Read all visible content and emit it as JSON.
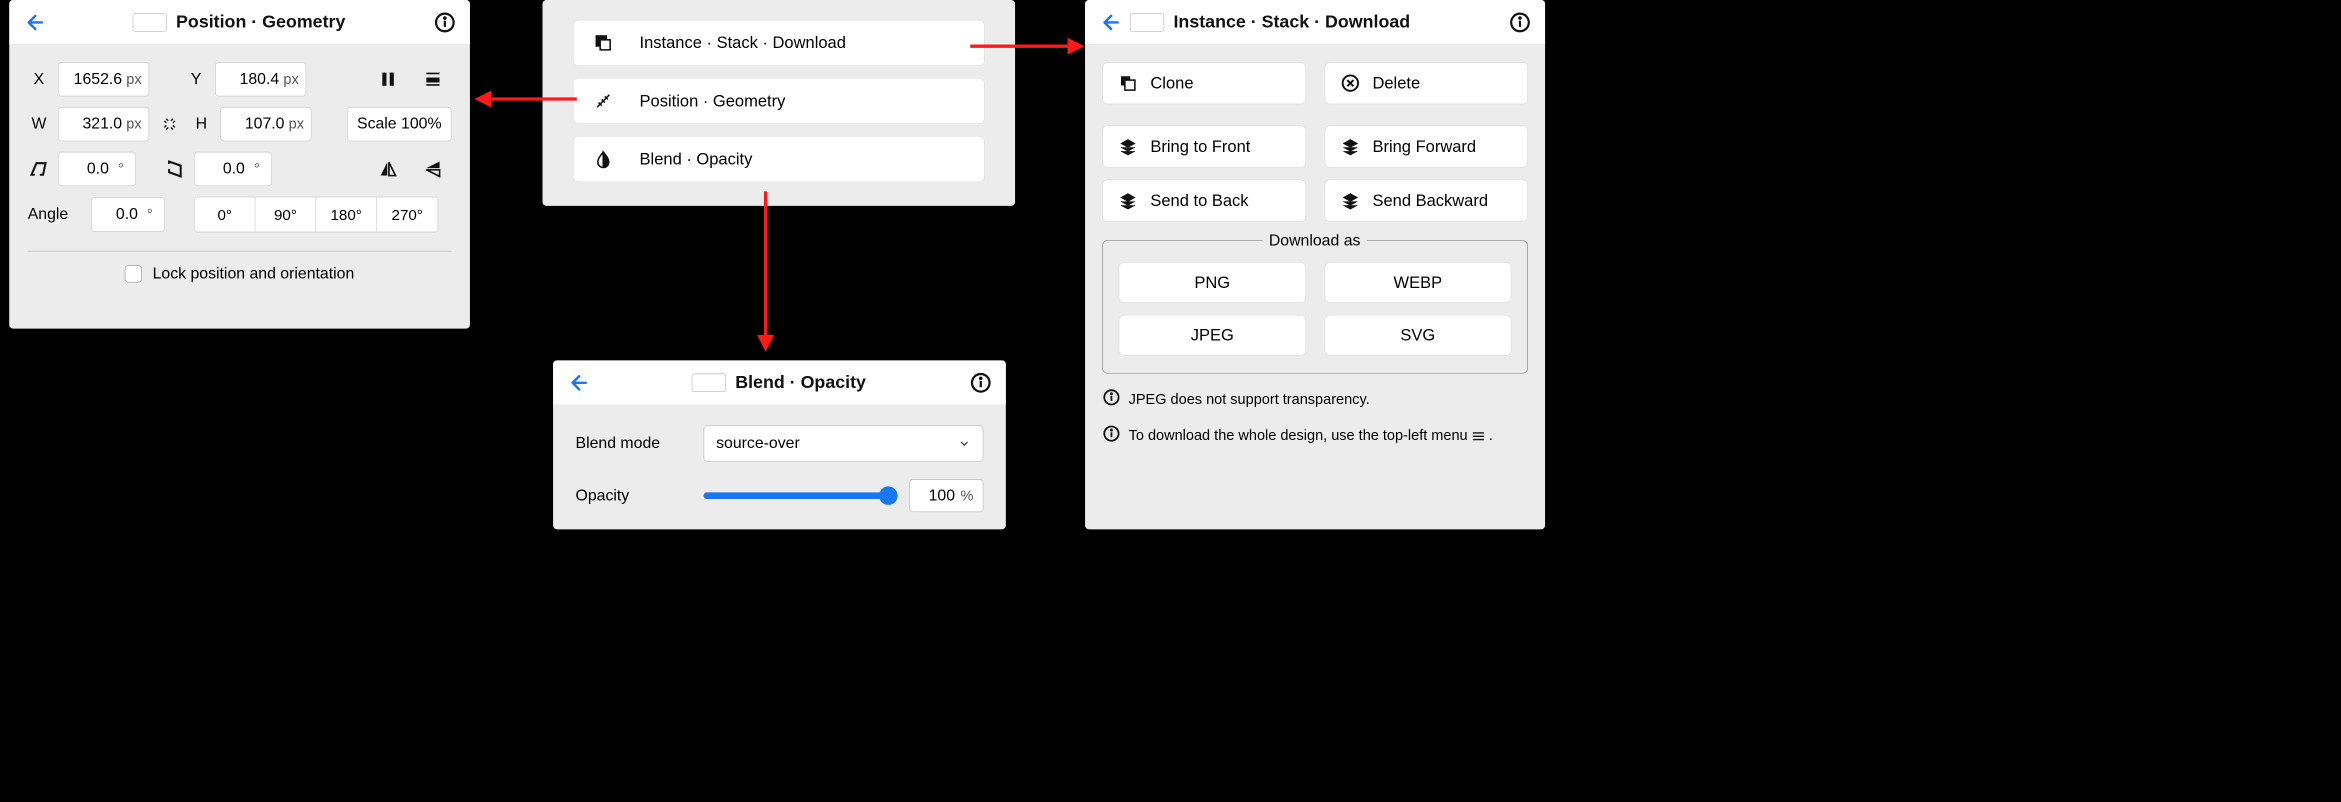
{
  "menu": {
    "items": [
      {
        "label": "Instance · Stack · Download",
        "icon": "duplicate-icon"
      },
      {
        "label": "Position · Geometry",
        "icon": "ruler-icon"
      },
      {
        "label": "Blend · Opacity",
        "icon": "opacity-icon"
      }
    ]
  },
  "position_panel": {
    "title": "Position · Geometry",
    "x_label": "X",
    "x_value": "1652.6",
    "x_unit": "px",
    "y_label": "Y",
    "y_value": "180.4",
    "y_unit": "px",
    "w_label": "W",
    "w_value": "321.0",
    "w_unit": "px",
    "h_label": "H",
    "h_value": "107.0",
    "h_unit": "px",
    "scale_label": "Scale 100%",
    "skewx_value": "0.0",
    "skewx_unit": "°",
    "skewy_value": "0.0",
    "skewy_unit": "°",
    "angle_label": "Angle",
    "angle_value": "0.0",
    "angle_unit": "°",
    "presets": [
      "0°",
      "90°",
      "180°",
      "270°"
    ],
    "lock_label": "Lock position and orientation"
  },
  "blend_panel": {
    "title": "Blend · Opacity",
    "mode_label": "Blend mode",
    "mode_value": "source-over",
    "opacity_label": "Opacity",
    "opacity_value": "100",
    "opacity_unit": "%"
  },
  "instance_panel": {
    "title": "Instance · Stack · Download",
    "actions": {
      "clone": "Clone",
      "delete": "Delete",
      "bring_front": "Bring to Front",
      "bring_forward": "Bring Forward",
      "send_back": "Send to Back",
      "send_backward": "Send Backward"
    },
    "download_legend": "Download as",
    "formats": [
      "PNG",
      "WEBP",
      "JPEG",
      "SVG"
    ],
    "note1": "JPEG does not support transparency.",
    "note2_a": "To download the whole design, use the top-left menu ",
    "note2_b": "."
  }
}
